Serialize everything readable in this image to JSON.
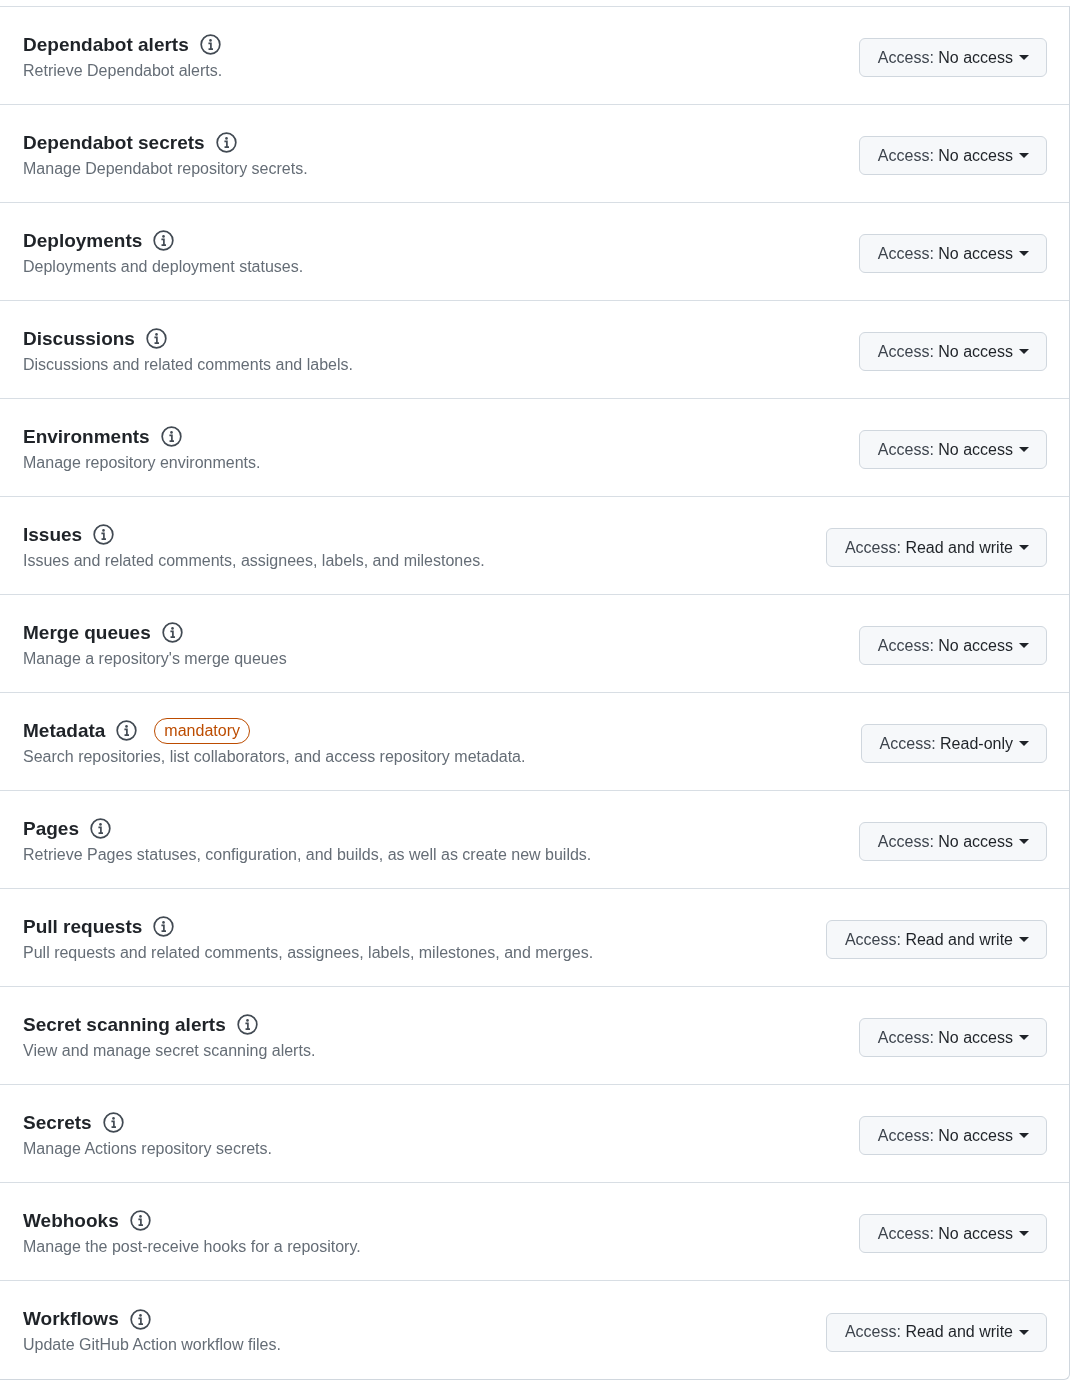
{
  "permissions": [
    {
      "name": "Dependabot alerts",
      "description": "Retrieve Dependabot alerts.",
      "access_label": "Access:",
      "access_value": "No access"
    },
    {
      "name": "Dependabot secrets",
      "description": "Manage Dependabot repository secrets.",
      "access_label": "Access:",
      "access_value": "No access"
    },
    {
      "name": "Deployments",
      "description": "Deployments and deployment statuses.",
      "access_label": "Access:",
      "access_value": "No access"
    },
    {
      "name": "Discussions",
      "description": "Discussions and related comments and labels.",
      "access_label": "Access:",
      "access_value": "No access"
    },
    {
      "name": "Environments",
      "description": "Manage repository environments.",
      "access_label": "Access:",
      "access_value": "No access"
    },
    {
      "name": "Issues",
      "description": "Issues and related comments, assignees, labels, and milestones.",
      "access_label": "Access:",
      "access_value": "Read and write"
    },
    {
      "name": "Merge queues",
      "description": "Manage a repository's merge queues",
      "access_label": "Access:",
      "access_value": "No access"
    },
    {
      "name": "Metadata",
      "badge": "mandatory",
      "description": "Search repositories, list collaborators, and access repository metadata.",
      "access_label": "Access:",
      "access_value": "Read-only"
    },
    {
      "name": "Pages",
      "description": "Retrieve Pages statuses, configuration, and builds, as well as create new builds.",
      "access_label": "Access:",
      "access_value": "No access"
    },
    {
      "name": "Pull requests",
      "description": "Pull requests and related comments, assignees, labels, milestones, and merges.",
      "access_label": "Access:",
      "access_value": "Read and write"
    },
    {
      "name": "Secret scanning alerts",
      "description": "View and manage secret scanning alerts.",
      "access_label": "Access:",
      "access_value": "No access"
    },
    {
      "name": "Secrets",
      "description": "Manage Actions repository secrets.",
      "access_label": "Access:",
      "access_value": "No access"
    },
    {
      "name": "Webhooks",
      "description": "Manage the post-receive hooks for a repository.",
      "access_label": "Access:",
      "access_value": "No access"
    },
    {
      "name": "Workflows",
      "description": "Update GitHub Action workflow files.",
      "access_label": "Access:",
      "access_value": "Read and write"
    }
  ]
}
